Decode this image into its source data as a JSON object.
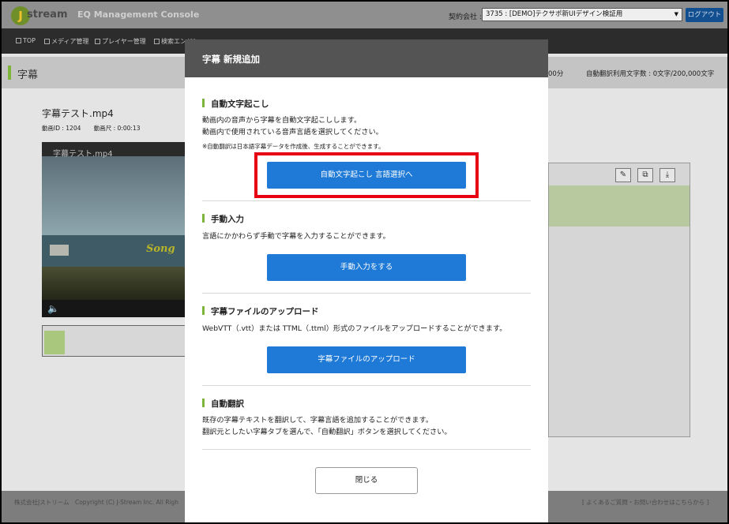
{
  "header": {
    "logo_text": "stream",
    "logo_letter": "J",
    "console_title": "EQ Management Console",
    "contract_label": "契約会社 :",
    "contract_value": "3735 : [DEMO]テクサポ新UIデザイン検証用",
    "logout_label": "ログアウト"
  },
  "nav": {
    "items": [
      "TOP",
      "メディア管理",
      "プレイヤー管理",
      "検索エンジン"
    ]
  },
  "page": {
    "title": "字幕",
    "stat_partial": "00分",
    "stat_translate": "自動翻訳利用文字数 : 0文字/200,000文字"
  },
  "video": {
    "name": "字幕テスト.mp4",
    "id_label": "動画ID : 1204",
    "duration_label": "動画尺 : 0:00:13",
    "player_title": "字幕テスト.mp4",
    "caption_overlay": "Song"
  },
  "footer": {
    "left": "株式会社Jストリーム　Copyright (C) J-Stream Inc. All Righ",
    "right": "[ よくあるご質問・お問い合わせはこちらから ]"
  },
  "modal": {
    "title": "字幕 新規追加",
    "sections": [
      {
        "heading": "自動文字起こし",
        "lines": [
          "動画内の音声から字幕を自動文字起こしします。",
          "動画内で使用されている音声言語を選択してください。"
        ],
        "note": "※自動翻訳は日本語字幕データを作成後、生成することができます。",
        "button": "自動文字起こし 言語選択へ"
      },
      {
        "heading": "手動入力",
        "lines": [
          "言語にかかわらず手動で字幕を入力することができます。"
        ],
        "button": "手動入力をする"
      },
      {
        "heading": "字幕ファイルのアップロード",
        "lines": [
          "WebVTT（.vtt）または TTML（.ttml）形式のファイルをアップロードすることができます。"
        ],
        "button": "字幕ファイルのアップロード"
      },
      {
        "heading": "自動翻訳",
        "lines": [
          "既存の字幕テキストを翻訳して、字幕言語を追加することができます。",
          "翻訳元としたい字幕タブを選んで、「自動翻訳」ボタンを選択してください。"
        ]
      }
    ],
    "close_label": "閉じる"
  },
  "colors": {
    "primary_button": "#1e7ad6",
    "accent_green": "#7db53a",
    "highlight_red": "#e60012",
    "modal_header": "#545454"
  }
}
